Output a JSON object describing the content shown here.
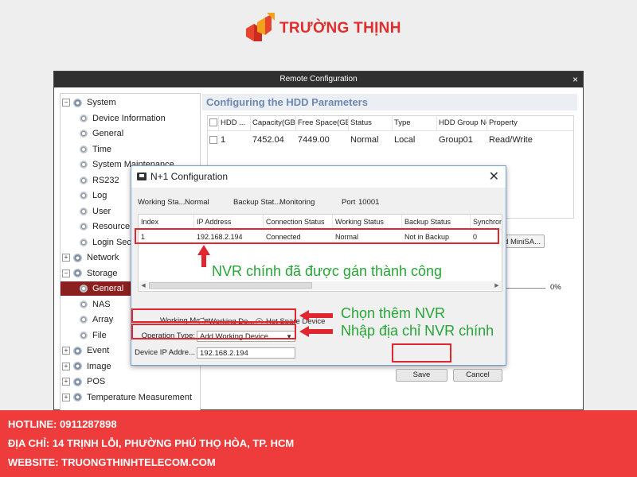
{
  "brand": {
    "name": "TRƯỜNG THỊNH"
  },
  "window": {
    "title": "Remote Configuration",
    "close": "×"
  },
  "tree": {
    "items": [
      {
        "label": "System",
        "level": 0,
        "expander": "−"
      },
      {
        "label": "Device Information",
        "level": 1
      },
      {
        "label": "General",
        "level": 1
      },
      {
        "label": "Time",
        "level": 1
      },
      {
        "label": "System Maintenance",
        "level": 1
      },
      {
        "label": "RS232",
        "level": 1
      },
      {
        "label": "Log",
        "level": 1
      },
      {
        "label": "User",
        "level": 1
      },
      {
        "label": "Resource U",
        "level": 1
      },
      {
        "label": "Login Secu",
        "level": 1
      },
      {
        "label": "Network",
        "level": 0,
        "expander": "+"
      },
      {
        "label": "Storage",
        "level": 0,
        "expander": "−"
      },
      {
        "label": "General",
        "level": 1,
        "selected": true
      },
      {
        "label": "NAS",
        "level": 1
      },
      {
        "label": "Array",
        "level": 1
      },
      {
        "label": "File",
        "level": 1
      },
      {
        "label": "Event",
        "level": 0,
        "expander": "+"
      },
      {
        "label": "Image",
        "level": 0,
        "expander": "+"
      },
      {
        "label": "POS",
        "level": 0,
        "expander": "+"
      },
      {
        "label": "Temperature Measurement",
        "level": 0,
        "expander": "+"
      }
    ]
  },
  "content": {
    "heading": "Configuring the HDD Parameters",
    "hdd_table": {
      "columns": [
        "HDD ...",
        "Capacity(GB)",
        "Free Space(GB)",
        "Status",
        "Type",
        "HDD Group No.",
        "Property"
      ],
      "rows": [
        [
          "1",
          "7452.04",
          "7449.00",
          "Normal",
          "Local",
          "Group01",
          "Read/Write"
        ]
      ]
    },
    "minisas_button": "nd MiniSA...",
    "progress_text": "0%"
  },
  "dialog": {
    "title": "N+1 Configuration",
    "close": "✕",
    "working_status_label": "Working Sta...",
    "working_status_value": "Normal",
    "backup_status_label": "Backup Stat...",
    "backup_status_value": "Monitoring",
    "port_label": "Port",
    "port_value": "10001",
    "table": {
      "columns": [
        "Index",
        "IP Address",
        "Connection Status",
        "Working Status",
        "Backup Status",
        "Synchron"
      ],
      "rows": [
        [
          "1",
          "192.168.2.194",
          "Connected",
          "Normal",
          "Not in Backup",
          "0"
        ]
      ]
    },
    "working_mode_label": "Working Mode:",
    "mode_working_device": "Working De...",
    "mode_hot_spare": "Hot Spare Device",
    "operation_type_label": "Operation Type:",
    "operation_type_value": "Add Working Device",
    "device_ip_label": "Device IP Addre...",
    "device_ip_value": "192.168.2.194",
    "save_button": "Save",
    "cancel_button": "Cancel"
  },
  "annotations": {
    "assigned": "NVR chính đã được gán thành công",
    "choose_nvr": "Chọn thêm NVR",
    "enter_ip": "Nhập địa chỉ NVR chính"
  },
  "footer": {
    "hotline": "HOTLINE: 0911287898",
    "address": "ĐỊA CHỈ: 14 TRỊNH LỖI, PHƯỜNG PHÚ THỌ HÒA, TP. HCM",
    "website": "WEBSITE: TRUONGTHINHTELECOM.COM"
  },
  "colors": {
    "brand_red": "#e02d2d",
    "footer_red": "#ee3b3c",
    "annotation_green": "#27a536",
    "highlight_red": "#e0262e",
    "heading_blue": "#6d89b2",
    "selected_tree": "#8c2020"
  }
}
